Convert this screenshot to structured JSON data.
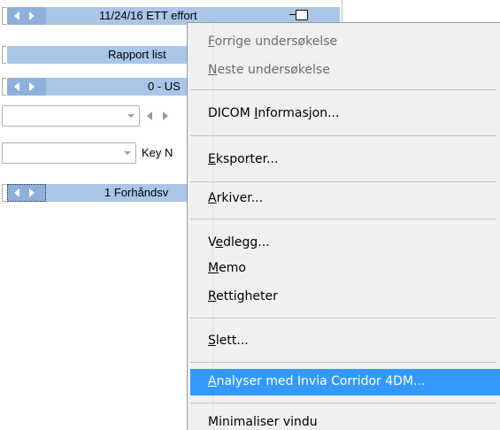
{
  "left_panel": {
    "row1_title": "11/24/16 ETT effort",
    "row2_title": "Rapport list",
    "row3_title": "0 - US",
    "combo2_label": "Key N",
    "row6_title": "1 Forhåndsv"
  },
  "menu": {
    "forrige": {
      "key": "F",
      "rest": "orrige undersøkelse"
    },
    "neste": {
      "key": "N",
      "rest": "este undersøkelse"
    },
    "dicom": {
      "pre": "DICOM ",
      "key": "I",
      "rest": "nformasjon..."
    },
    "eksporter": {
      "key": "E",
      "rest": "ksporter..."
    },
    "arkiver": {
      "key": "A",
      "rest": "rkiver..."
    },
    "vedlegg": {
      "pre": "V",
      "key": "e",
      "rest": "dlegg..."
    },
    "memo": {
      "key": "M",
      "rest": "emo"
    },
    "rettigheter": {
      "key": "R",
      "rest": "ettigheter"
    },
    "slett": {
      "key": "S",
      "rest": "lett..."
    },
    "analyser": {
      "key": "A",
      "rest": "nalyser med Invia Corridor 4DM..."
    },
    "minimaliser": {
      "label": "Minimaliser vindu"
    }
  },
  "colors": {
    "nav_bar": "#a9c6e8",
    "nav_arrows": "#8fb0da",
    "menu_bg": "#f0f0f0",
    "menu_highlight": "#3399ff",
    "disabled_text": "#6d6d6d"
  }
}
